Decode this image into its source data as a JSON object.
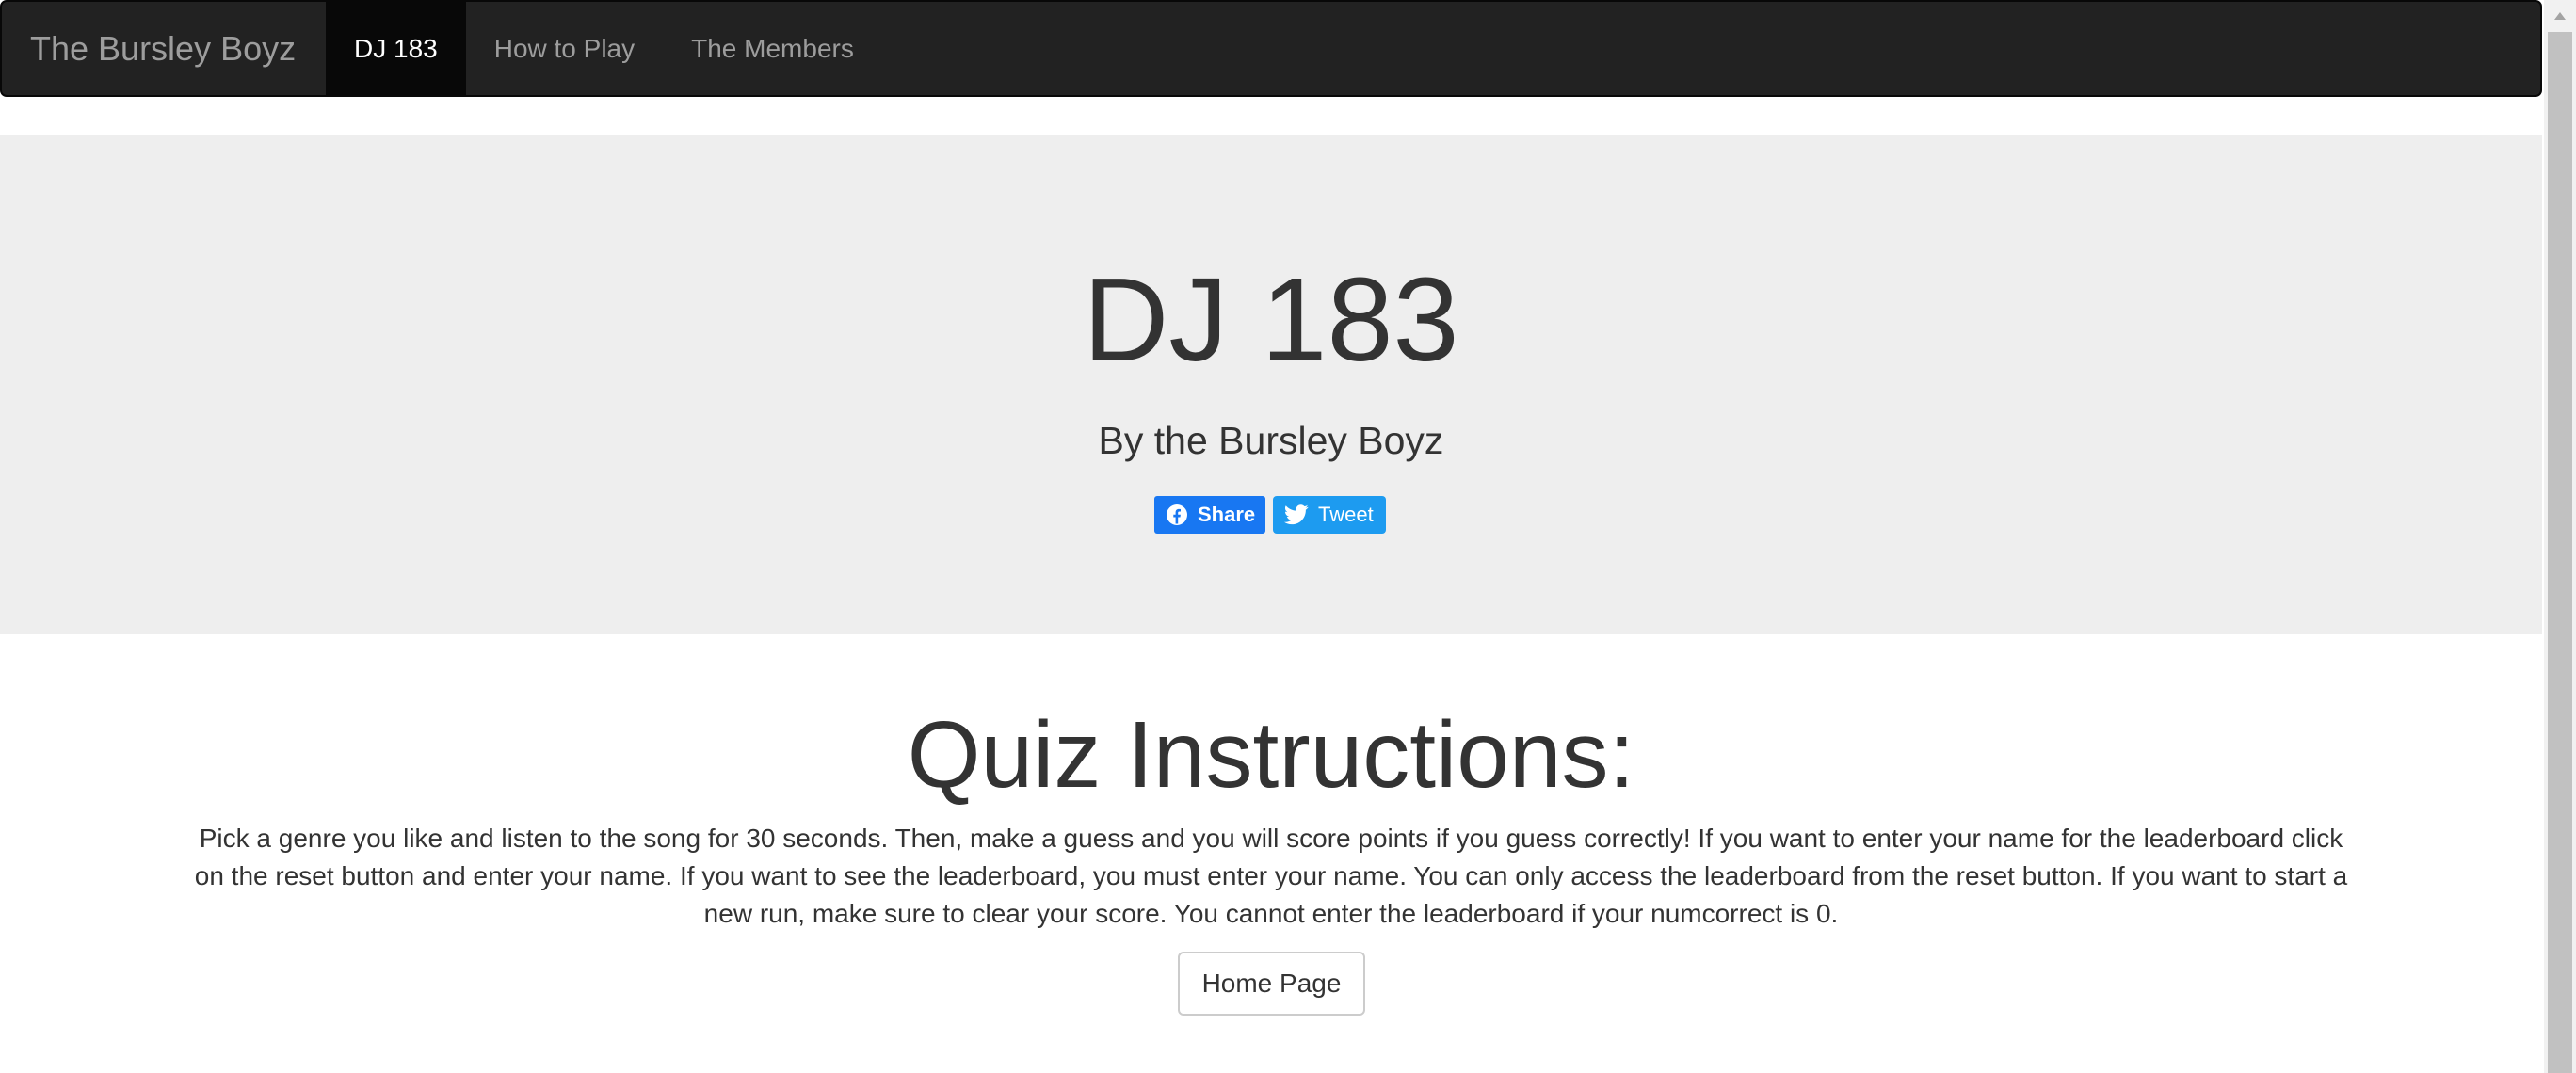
{
  "navbar": {
    "brand": "The Bursley Boyz",
    "items": [
      {
        "label": "DJ 183",
        "active": true
      },
      {
        "label": "How to Play",
        "active": false
      },
      {
        "label": "The Members",
        "active": false
      }
    ]
  },
  "hero": {
    "title": "DJ 183",
    "subtitle": "By the Bursley Boyz",
    "share_label": "Share",
    "tweet_label": "Tweet"
  },
  "instructions": {
    "heading": "Quiz Instructions:",
    "text": "Pick a genre you like and listen to the song for 30 seconds. Then, make a guess and you will score points if you guess correctly! If you want to enter your name for the leaderboard click on the reset button and enter your name. If you want to see the leaderboard, you must enter your name. You can only access the leaderboard from the reset button. If you want to start a new run, make sure to clear your score. You cannot enter the leaderboard if your numcorrect is 0.",
    "home_button": "Home Page"
  },
  "icons": {
    "facebook": "facebook-icon",
    "twitter": "twitter-icon",
    "scroll_up": "chevron-up-icon"
  },
  "colors": {
    "navbar_bg": "#222222",
    "active_nav_bg": "#080808",
    "jumbotron_bg": "#eeeeee",
    "facebook_blue": "#1877f2",
    "twitter_blue": "#1d9bf0"
  }
}
